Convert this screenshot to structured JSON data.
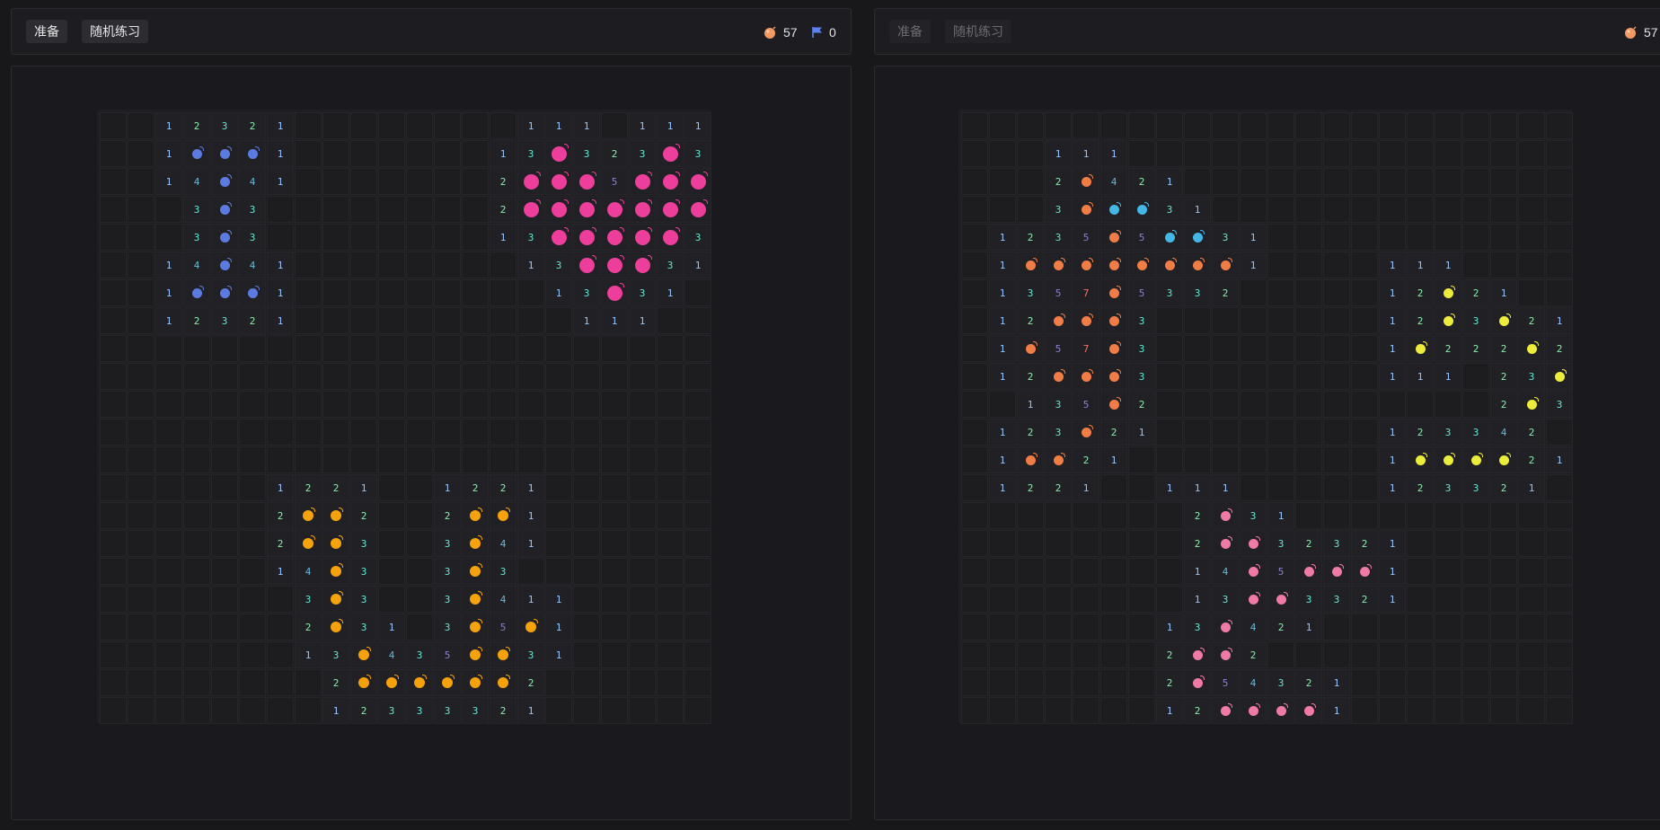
{
  "colors": {
    "blue": "#5b7be0",
    "pink": "#ec3e9a",
    "orange": "#f5a20c",
    "coral": "#f07c46",
    "cyan": "#43b7e6",
    "yellow": "#ecec3a",
    "rose": "#f07aa6",
    "flag": "#5b82f0"
  },
  "left": {
    "ready_label": "准备",
    "practice_label": "随机练习",
    "mine_count": "57",
    "flag_count": "0",
    "board": [
      "..12321........111.111.",
      "..1bbb1.......13P323P31",
      "..14b41.......2PPP5PPP2",
      "...3b3........2PPPPPPP2",
      "...3b3........13PPPPP31",
      "..14b41........13PPP31.",
      "..1bbb1.........13P31..",
      "..12321..........111...",
      "......................",
      "......................",
      "......................",
      "......................",
      "......................",
      "......1221..1221......",
      "......2OO2..2OO1......",
      "......2OO3..3O41......",
      "......14O3..3O3.......",
      ".......3O3..3O411.....",
      ".......2O31.3O5O1.....",
      ".......13O435OO31.....",
      "........2OOOOOO2......",
      "........12333321......"
    ]
  },
  "right": {
    "ready_label": "准备",
    "practice_label": "随机练习",
    "mine_count": "57",
    "board": [
      "......................",
      "...111................",
      "...2c421..............",
      "...3cCC31.............",
      ".1235c5CC31...........",
      ".1cccccccc1....111....",
      ".1357c5332l....12Y21..",
      ".12ccc3........12Y3Y21",
      ".1c57c3........1Y222Y21",
      ".12ccc3........111.23Y1",
      "..135c2............2Y31",
      ".123c21........123342..",
      ".1cc21.........1YYYY21",
      ".1221..111.....123321",
      "........2R31..........",
      "........2RR32321......",
      "........14R5RRR1......",
      "........13RR3321......",
      ".......13R421.........",
      ".......2RR2............",
      ".......2R54321.........",
      ".......12RRRR1........"
    ]
  }
}
